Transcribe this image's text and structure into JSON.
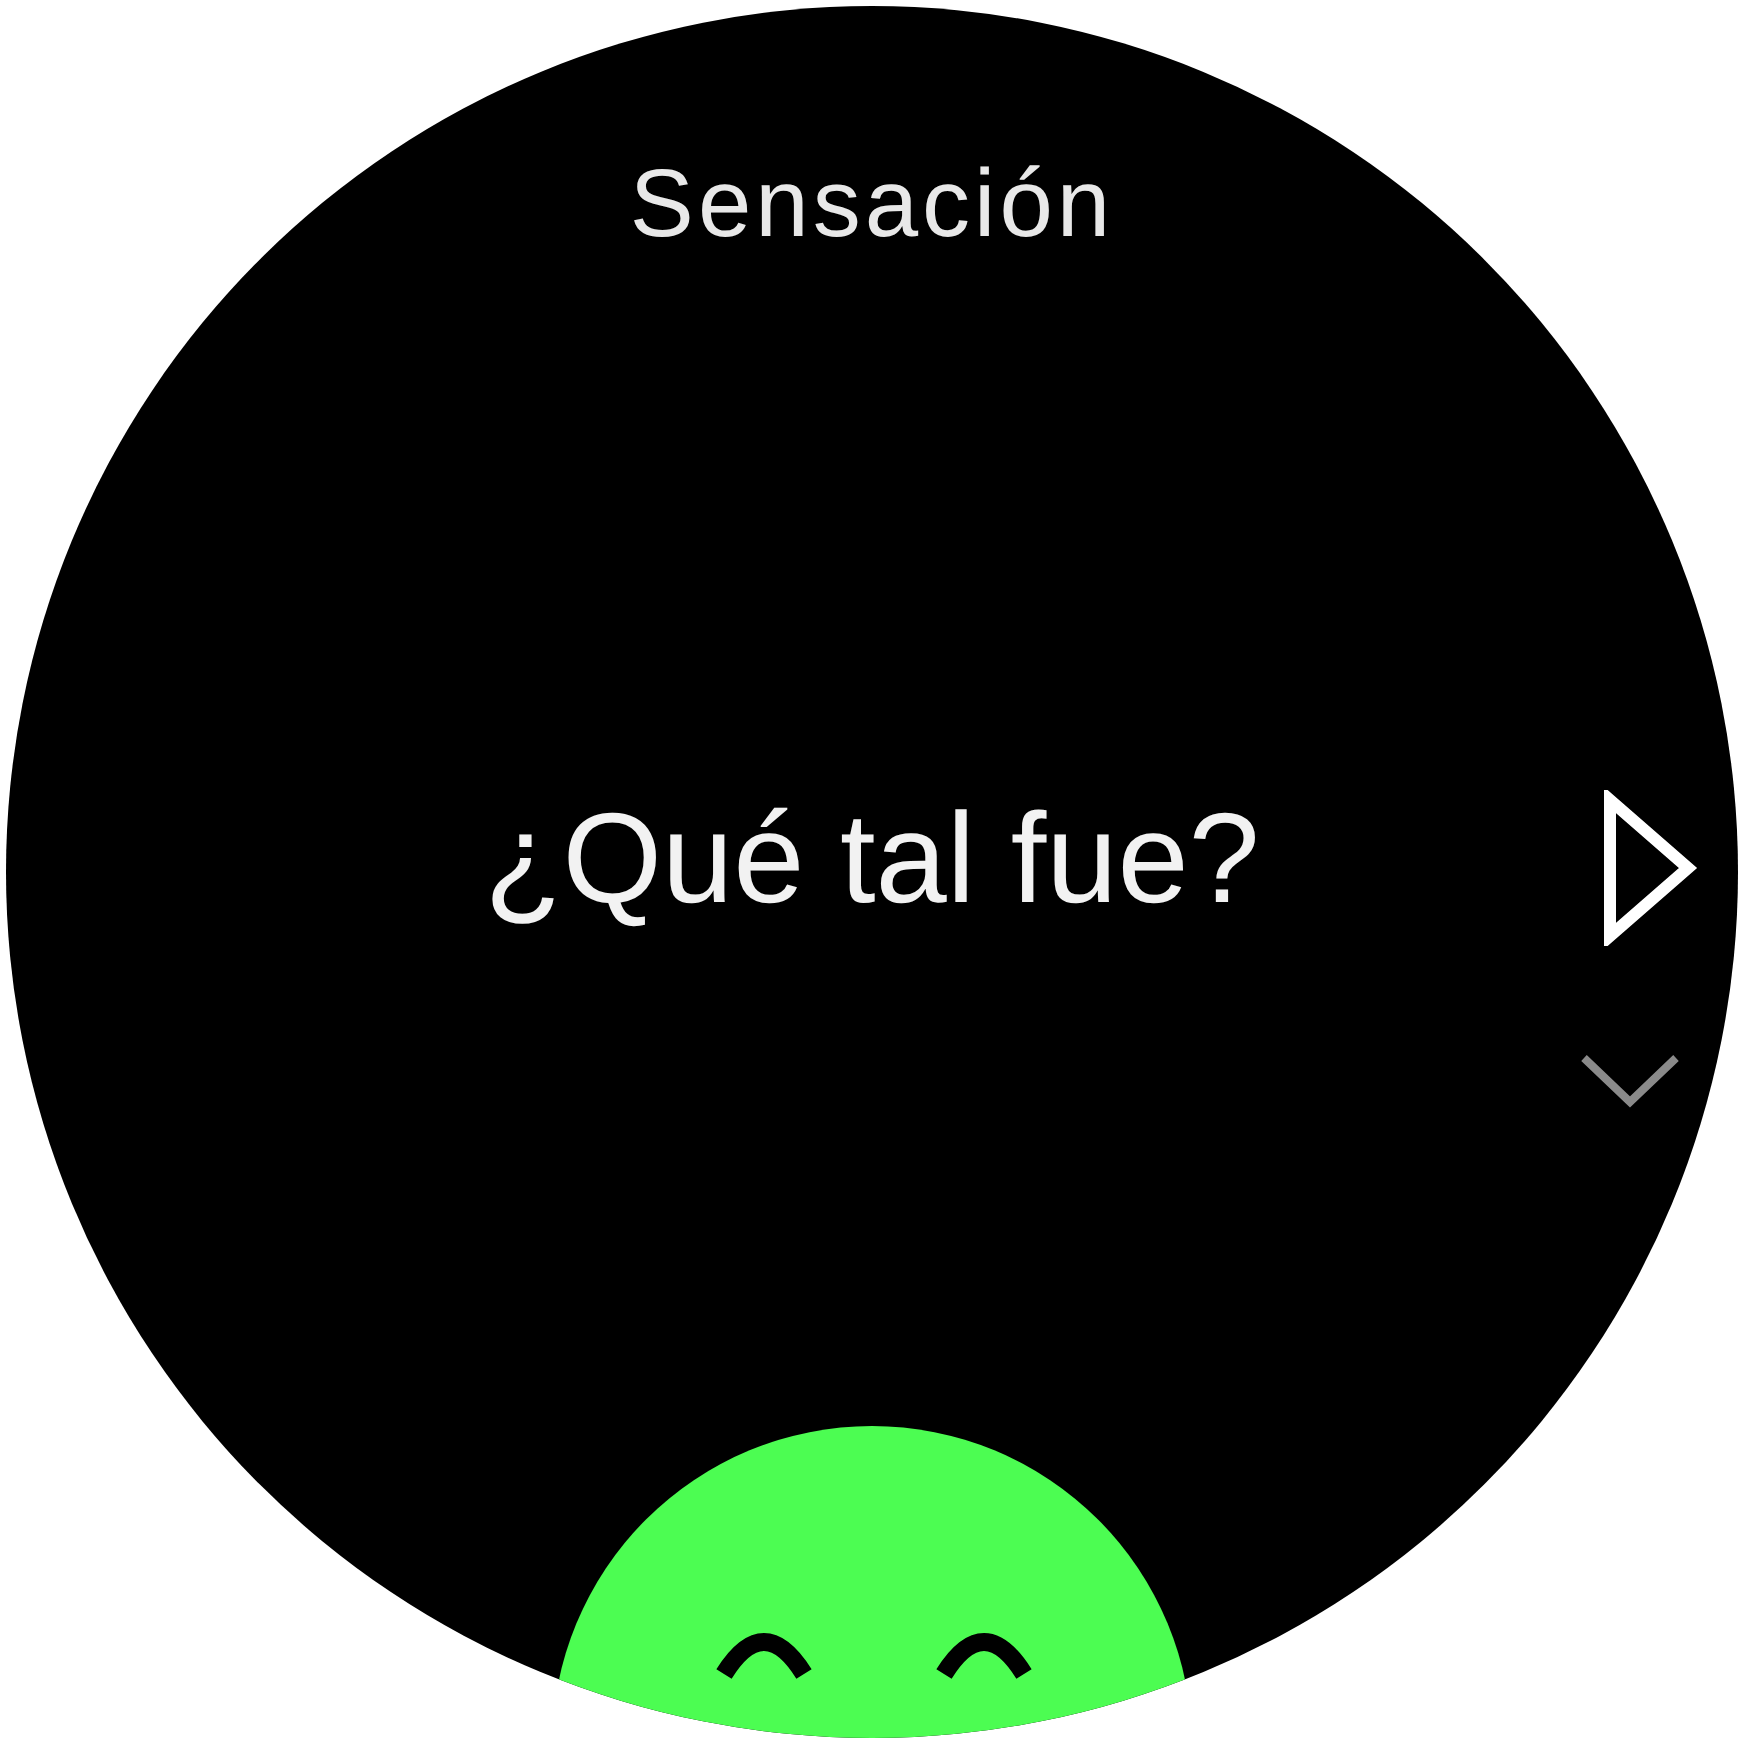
{
  "title": "Sensación",
  "question": "¿Qué tal fue?"
}
